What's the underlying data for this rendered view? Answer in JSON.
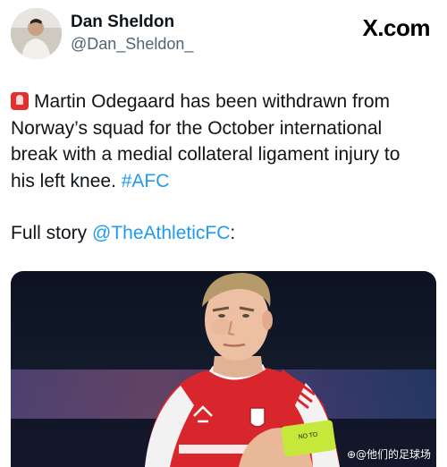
{
  "author": {
    "name": "Dan Sheldon",
    "handle": "@Dan_Sheldon_"
  },
  "brand": "X.com",
  "tweet": {
    "line1": "Martin Odegaard has been withdrawn from",
    "line2": "Norway’s squad for the October international",
    "line3": "break with a medial collateral ligament injury to",
    "line4_text": "his left knee. ",
    "hashtag": "#AFC",
    "full_story_text": "Full story ",
    "mention": "@TheAthleticFC",
    "mention_suffix": ":"
  },
  "media": {
    "armband_text": "NO TO",
    "watermark": "⊕@他们的足球场"
  },
  "colors": {
    "link": "#1d9bf0",
    "arsenal_red": "#d8262c"
  },
  "icons": {
    "siren": "siren-emoji-icon"
  }
}
